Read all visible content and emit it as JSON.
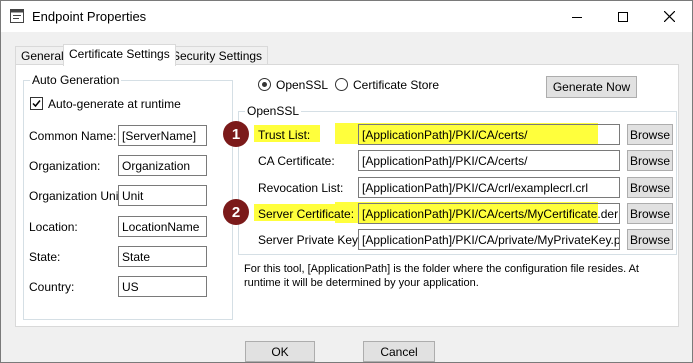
{
  "window": {
    "title": "Endpoint Properties"
  },
  "titlebar": {
    "minimize": "—",
    "maximize": "☐",
    "close": "✕"
  },
  "tabs": [
    "General",
    "Certificate Settings",
    "Security Settings"
  ],
  "auto_generation": {
    "legend": "Auto Generation",
    "checkbox_label": "Auto-generate at runtime",
    "checked": true,
    "fields": [
      {
        "label": "Common Name:",
        "value": "[ServerName]"
      },
      {
        "label": "Organization:",
        "value": "Organization"
      },
      {
        "label": "Organization Unit:",
        "value": "Unit"
      },
      {
        "label": "Location:",
        "value": "LocationName"
      },
      {
        "label": "State:",
        "value": "State"
      },
      {
        "label": "Country:",
        "value": "US"
      }
    ]
  },
  "store_type": {
    "options": [
      "OpenSSL",
      "Certificate Store"
    ],
    "selected": "OpenSSL"
  },
  "generate_now": "Generate Now",
  "openssl": {
    "legend": "OpenSSL",
    "rows": [
      {
        "label": "Trust List:",
        "value": "[ApplicationPath]/PKI/CA/certs/",
        "highlight": true,
        "badge": "1"
      },
      {
        "label": "CA Certificate:",
        "value": "[ApplicationPath]/PKI/CA/certs/",
        "highlight": false
      },
      {
        "label": "Revocation List:",
        "value": "[ApplicationPath]/PKI/CA/crl/examplecrl.crl",
        "highlight": false
      },
      {
        "label": "Server Certificate:",
        "value": "[ApplicationPath]/PKI/CA/certs/MyCertificate.der",
        "highlight": true,
        "badge": "2"
      },
      {
        "label": "Server Private Key:",
        "value": "[ApplicationPath]/PKI/CA/private/MyPrivateKey.pem",
        "highlight": false
      }
    ],
    "browse": "Browse"
  },
  "note": "For this tool, [ApplicationPath] is the folder where the configuration file resides. At runtime it will be determined by your application.",
  "footer": {
    "ok": "OK",
    "cancel": "Cancel"
  },
  "colors": {
    "highlight": "#ffff3c",
    "badge": "#7b1a1a"
  },
  "icons": [
    "window-icon",
    "checkmark-icon"
  ]
}
